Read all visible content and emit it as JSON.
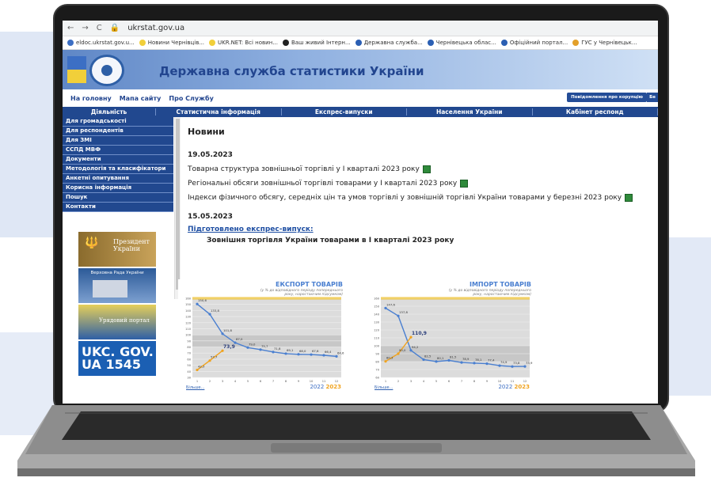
{
  "browser": {
    "url": "ukrstat.gov.ua",
    "bookmarks": [
      "eldoc.ukrstat.gov.u...",
      "Новини Чернівців...",
      "UKR.NET: Всі новин...",
      "Ваш живий Інтерн...",
      "Державна служба...",
      "Чернівецька облас...",
      "Офіційний портал...",
      "ГУС у Чернівецьк..."
    ]
  },
  "site": {
    "title": "Державна служба статистики України",
    "subnav": [
      "На головну",
      "Мапа сайту",
      "Про Службу"
    ],
    "corruption_btn": "Повідомлення про корупцію",
    "main_nav": [
      "Діяльність",
      "Статистична інформація",
      "Експрес-випуски",
      "Населення України",
      "Кабінет респонд"
    ],
    "sidebar": [
      "Для громадськості",
      "Для респондентів",
      "Для ЗМІ",
      "ССПД МВФ",
      "Документи",
      "Методологія та класифікатори",
      "Анкетні опитування",
      "Корисна інформація",
      "Пошук",
      "Контакти"
    ],
    "banners": [
      "Президент України",
      "Верховна Рада України",
      "Урядовий портал",
      "UKC. GOV. UA 1545"
    ]
  },
  "content": {
    "heading": "Новини",
    "dates": [
      "19.05.2023",
      "15.05.2023"
    ],
    "news": [
      "Товарна структура зовнішньої торгівлі у I кварталі 2023 року",
      "Регіональні обсяги зовнішньої торгівлі товарами у I кварталі 2023 року",
      "Індекси фізичного обсягу, середніх цін та умов торгівлі у зовнішній торгівлі України товарами у березні 2023 року"
    ],
    "express_link": "Підготовлено експрес-випуск:",
    "express_title": "Зовнішня торгівля України товарами в I кварталі 2023 року",
    "source_link": "Більше..."
  },
  "chart_data": [
    {
      "type": "line",
      "title": "ЕКСПОРТ ТОВАРІВ",
      "note": "(у % до відповідного періоду попереднього року, наростаючим підсумком)",
      "x": [
        1,
        2,
        3,
        4,
        5,
        6,
        7,
        8,
        9,
        10,
        11,
        12
      ],
      "series": [
        {
          "name": "2022",
          "values": [
            150.6,
            133.8,
            101.8,
            87.0,
            79.0,
            75.7,
            71.8,
            69.1,
            68.0,
            67.6,
            66.4,
            64.6
          ]
        },
        {
          "name": "2023",
          "values": [
            42.3,
            57.7,
            73.9
          ]
        }
      ],
      "labels_2022": [
        "150,6",
        "133,8",
        "101,8",
        "87,0",
        "79,0",
        "75,7",
        "71,8",
        "69,1",
        "68,0",
        "67,6",
        "66,4",
        "64,6"
      ],
      "labels_2023": [
        "42,3",
        "57,7",
        "73,9"
      ],
      "ylim": [
        30,
        160
      ],
      "ytick_labels": [
        "160",
        "150",
        "140",
        "130",
        "120",
        "110",
        "100",
        "90",
        "80",
        "70",
        "60",
        "50",
        "40",
        "30"
      ],
      "xtick_labels": [
        "1",
        "2",
        "3",
        "4",
        "5",
        "6",
        "7",
        "8",
        "9",
        "10",
        "11",
        "12"
      ],
      "legend": "bottom-right",
      "colors": {
        "2022": "#4a7fd0",
        "2023": "#f0a31f"
      }
    },
    {
      "type": "line",
      "title": "ІМПОРТ ТОВАРІВ",
      "note": "(у % до відповідного періоду попереднього року, наростаючим підсумком)",
      "x": [
        1,
        2,
        3,
        4,
        5,
        6,
        7,
        8,
        9,
        10,
        11,
        12
      ],
      "series": [
        {
          "name": "2022",
          "values": [
            147.6,
            137.8,
            94.2,
            82.5,
            80.1,
            81.5,
            78.9,
            78.1,
            77.4,
            74.9,
            73.8,
            73.9
          ]
        },
        {
          "name": "2023",
          "values": [
            80.3,
            90.0,
            110.9
          ]
        }
      ],
      "labels_2022": [
        "147,6",
        "137,8",
        "94,2",
        "82,5",
        "80,1",
        "81,5",
        "78,9",
        "78,1",
        "77,4",
        "74,9",
        "73,8",
        "73,9"
      ],
      "labels_2023": [
        "80,3",
        "90,0",
        "110,9"
      ],
      "ylim": [
        60,
        160
      ],
      "ytick_labels": [
        "160",
        "150",
        "140",
        "130",
        "120",
        "110",
        "100",
        "90",
        "80",
        "70",
        "60"
      ],
      "xtick_labels": [
        "1",
        "2",
        "3",
        "4",
        "5",
        "6",
        "7",
        "8",
        "9",
        "10",
        "11",
        "12"
      ],
      "legend": "bottom-right",
      "colors": {
        "2022": "#4a7fd0",
        "2023": "#f0a31f"
      }
    }
  ]
}
